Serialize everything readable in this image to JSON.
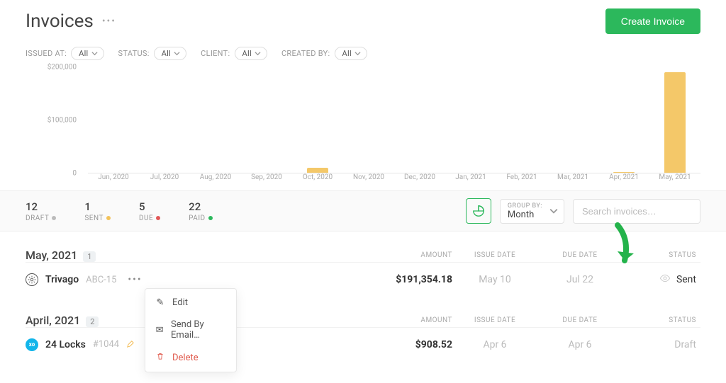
{
  "header": {
    "title": "Invoices",
    "create_btn": "Create Invoice"
  },
  "filters": [
    {
      "label": "ISSUED AT:",
      "value": "All"
    },
    {
      "label": "STATUS:",
      "value": "All"
    },
    {
      "label": "CLIENT:",
      "value": "All"
    },
    {
      "label": "CREATED BY:",
      "value": "All"
    }
  ],
  "chart_data": {
    "type": "bar",
    "categories": [
      "Jun, 2020",
      "Jul, 2020",
      "Aug, 2020",
      "Sep, 2020",
      "Oct, 2020",
      "Nov, 2020",
      "Dec, 2020",
      "Jan, 2021",
      "Feb, 2021",
      "Mar, 2021",
      "Apr, 2021",
      "May, 2021"
    ],
    "values": [
      0,
      0,
      0,
      0,
      10000,
      0,
      0,
      0,
      0,
      0,
      1000,
      191000
    ],
    "ylabel": "",
    "ylim": [
      0,
      200000
    ],
    "y_ticks": [
      "$200,000",
      "$100,000",
      "0"
    ]
  },
  "status_counts": [
    {
      "count": "12",
      "label": "DRAFT",
      "color": "grey"
    },
    {
      "count": "1",
      "label": "SENT",
      "color": "yellow"
    },
    {
      "count": "5",
      "label": "DUE",
      "color": "red"
    },
    {
      "count": "22",
      "label": "PAID",
      "color": "green"
    }
  ],
  "group_by": {
    "label": "GROUP BY:",
    "value": "Month"
  },
  "search": {
    "placeholder": "Search invoices…"
  },
  "sections": [
    {
      "title": "May, 2021",
      "count": "1",
      "columns": {
        "amount": "AMOUNT",
        "issue": "ISSUE DATE",
        "due": "DUE DATE",
        "status": "STATUS"
      },
      "rows": [
        {
          "client": "Trivago",
          "inv_id": "ABC-15",
          "amount": "$191,354.18",
          "issue": "May 10",
          "due": "Jul 22",
          "status": "Sent",
          "icon": "gear",
          "seen": true,
          "menu_open": true
        }
      ]
    },
    {
      "title": "April, 2021",
      "count": "2",
      "columns": {
        "amount": "AMOUNT",
        "issue": "ISSUE DATE",
        "due": "DUE DATE",
        "status": "STATUS"
      },
      "rows": [
        {
          "client": "24 Locks",
          "inv_id": "#1044",
          "amount": "$908.52",
          "issue": "Apr 6",
          "due": "Apr 6",
          "status": "Draft",
          "icon": "xero",
          "edit_icon": true
        }
      ]
    }
  ],
  "dropdown": {
    "edit": "Edit",
    "email": "Send By Email…",
    "delete": "Delete"
  }
}
